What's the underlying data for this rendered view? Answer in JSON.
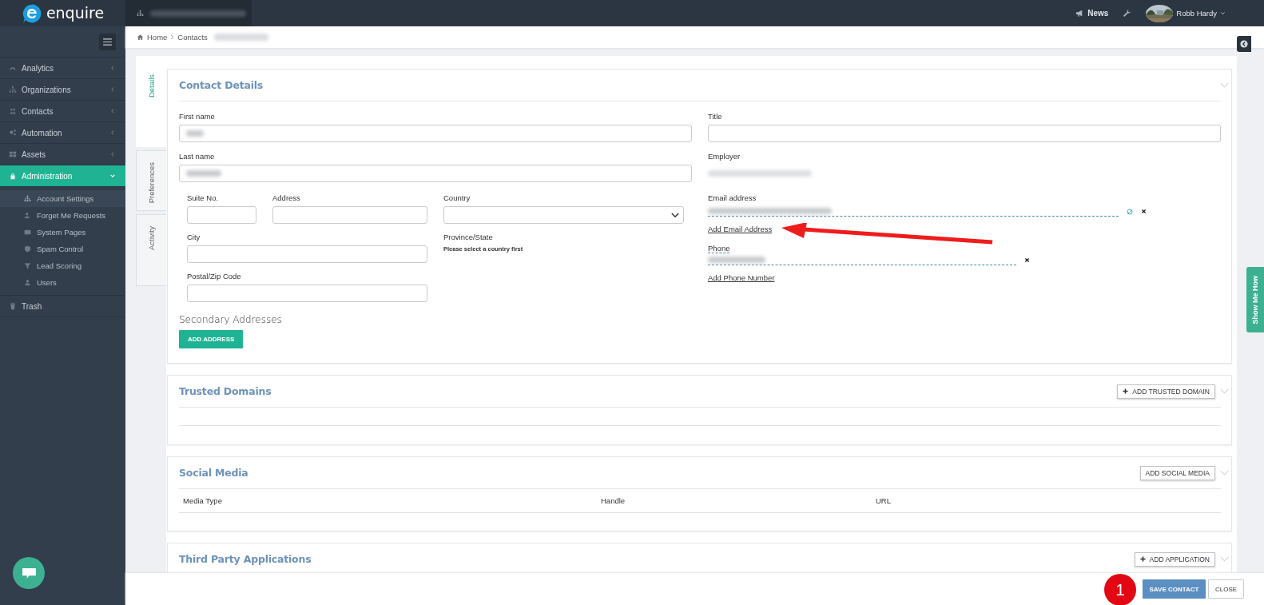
{
  "topbar": {
    "logo_text": "enquire",
    "news": "News",
    "user": "Robb Hardy"
  },
  "sidebar": {
    "items": [
      {
        "label": "Analytics",
        "expanded": false,
        "selected": false
      },
      {
        "label": "Organizations",
        "expanded": false,
        "selected": false
      },
      {
        "label": "Contacts",
        "expanded": false,
        "selected": false
      },
      {
        "label": "Automation",
        "expanded": false,
        "selected": false
      },
      {
        "label": "Assets",
        "expanded": false,
        "selected": false
      },
      {
        "label": "Administration",
        "expanded": true,
        "selected": true,
        "children": [
          {
            "label": "Account Settings",
            "selected": true
          },
          {
            "label": "Forget Me Requests",
            "selected": false
          },
          {
            "label": "System Pages",
            "selected": false
          },
          {
            "label": "Spam Control",
            "selected": false
          },
          {
            "label": "Lead Scoring",
            "selected": false
          },
          {
            "label": "Users",
            "selected": false
          }
        ]
      },
      {
        "label": "Trash",
        "selected": false
      }
    ]
  },
  "breadcrumb": [
    "Home",
    "Contacts"
  ],
  "side_tabs": [
    {
      "label": "Details",
      "selected": true
    },
    {
      "label": "Preferences",
      "selected": false
    },
    {
      "label": "Activity",
      "selected": false
    }
  ],
  "contact_details": {
    "title": "Contact Details",
    "first_name": {
      "label": "First name"
    },
    "last_name": {
      "label": "Last name"
    },
    "suite": {
      "label": "Suite No."
    },
    "address": {
      "label": "Address"
    },
    "country": {
      "label": "Country"
    },
    "city": {
      "label": "City"
    },
    "province": {
      "label": "Province/State",
      "note": "Please select a country first"
    },
    "postal": {
      "label": "Postal/Zip Code"
    },
    "secondary": {
      "title": "Secondary Addresses",
      "button": "ADD ADDRESS"
    },
    "title_field": {
      "label": "Title"
    },
    "employer": {
      "label": "Employer"
    },
    "email": {
      "label": "Email address",
      "add_link": "Add Email Address"
    },
    "phone": {
      "label": "Phone",
      "add_link": "Add Phone Number"
    }
  },
  "trusted_domains": {
    "title": "Trusted Domains",
    "button": "ADD TRUSTED DOMAIN"
  },
  "social_media": {
    "title": "Social Media",
    "button": "ADD SOCIAL MEDIA",
    "columns": [
      "Media Type",
      "Handle",
      "URL"
    ]
  },
  "third_party": {
    "title": "Third Party Applications",
    "button": "ADD APPLICATION"
  },
  "footer": {
    "buttons": [
      {
        "label": "SAVE CONTACT",
        "kind": "primary"
      },
      {
        "label": "CLOSE",
        "kind": "default"
      }
    ]
  },
  "show_me_how": "Show Me How",
  "annotation": {
    "step": "1"
  }
}
